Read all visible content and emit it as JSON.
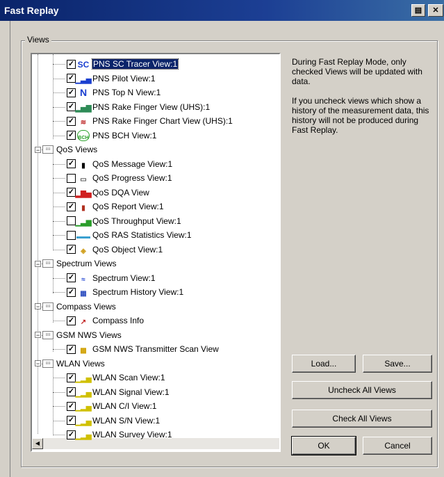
{
  "window": {
    "title": "Fast Replay"
  },
  "group": {
    "label": "Views"
  },
  "tree": [
    {
      "label": "PNS SC Tracer View:1",
      "checked": true,
      "icon": "SC",
      "icon_color": "#1a3fd0",
      "selected": true
    },
    {
      "label": "PNS Pilot View:1",
      "checked": true,
      "icon": "bars",
      "icon_color": "#1a3fd0"
    },
    {
      "label": "PNS Top N View:1",
      "checked": true,
      "icon": "N",
      "icon_color": "#1a3fd0"
    },
    {
      "label": "PNS Rake Finger View (UHS):1",
      "checked": true,
      "icon": "rake",
      "icon_color": "#2e8b57"
    },
    {
      "label": "PNS Rake Finger Chart View (UHS):1",
      "checked": true,
      "icon": "chart",
      "icon_color": "#c03030"
    },
    {
      "label": "PNS BCH View:1",
      "checked": true,
      "icon": "BCH",
      "icon_color": "#2aa02a"
    },
    {
      "label": "QoS Views",
      "group": true
    },
    {
      "label": "QoS Message View:1",
      "checked": true,
      "icon": "clipboard",
      "icon_color": "#000000"
    },
    {
      "label": "QoS Progress View:1",
      "checked": false,
      "icon": "progress",
      "icon_color": "#555555"
    },
    {
      "label": "QoS DQA View",
      "checked": true,
      "icon": "dqa",
      "icon_color": "#d02020"
    },
    {
      "label": "QoS Report View:1",
      "checked": true,
      "icon": "report",
      "icon_color": "#b03020"
    },
    {
      "label": "QoS Throughput View:1",
      "checked": false,
      "icon": "throughput",
      "icon_color": "#2a9d2a"
    },
    {
      "label": "QoS RAS Statistics View:1",
      "checked": false,
      "icon": "ras",
      "icon_color": "#3aa0d0"
    },
    {
      "label": "QoS Object View:1",
      "checked": true,
      "icon": "object",
      "icon_color": "#d0a020"
    },
    {
      "label": "Spectrum Views",
      "group": true
    },
    {
      "label": "Spectrum View:1",
      "checked": true,
      "icon": "spectrum",
      "icon_color": "#1a3fd0"
    },
    {
      "label": "Spectrum History View:1",
      "checked": true,
      "icon": "history",
      "icon_color": "#3050c0"
    },
    {
      "label": "Compass Views",
      "group": true
    },
    {
      "label": "Compass Info",
      "checked": true,
      "icon": "compass",
      "icon_color": "#c02020"
    },
    {
      "label": "GSM NWS Views",
      "group": true
    },
    {
      "label": "GSM NWS Transmitter Scan View",
      "checked": true,
      "icon": "gsm",
      "icon_color": "#d0a000"
    },
    {
      "label": "WLAN Views",
      "group": true
    },
    {
      "label": "WLAN Scan View:1",
      "checked": true,
      "icon": "wlan",
      "icon_color": "#d0c000"
    },
    {
      "label": "WLAN Signal View:1",
      "checked": true,
      "icon": "wlan",
      "icon_color": "#d0c000"
    },
    {
      "label": "WLAN C/I View:1",
      "checked": true,
      "icon": "wlan",
      "icon_color": "#d0c000"
    },
    {
      "label": "WLAN S/N View:1",
      "checked": true,
      "icon": "wlan",
      "icon_color": "#d0c000"
    },
    {
      "label": "WLAN Survey View:1",
      "checked": true,
      "icon": "wlan",
      "icon_color": "#d0c000"
    }
  ],
  "info": {
    "p1": "During Fast Replay Mode, only checked Views will be updated with data.",
    "p2": "If you uncheck views which show a history of the measurement data, this history will not be produced during Fast Replay."
  },
  "buttons": {
    "load": "Load...",
    "save": "Save...",
    "uncheck_all": "Uncheck All Views",
    "check_all": "Check All Views",
    "ok": "OK",
    "cancel": "Cancel"
  }
}
